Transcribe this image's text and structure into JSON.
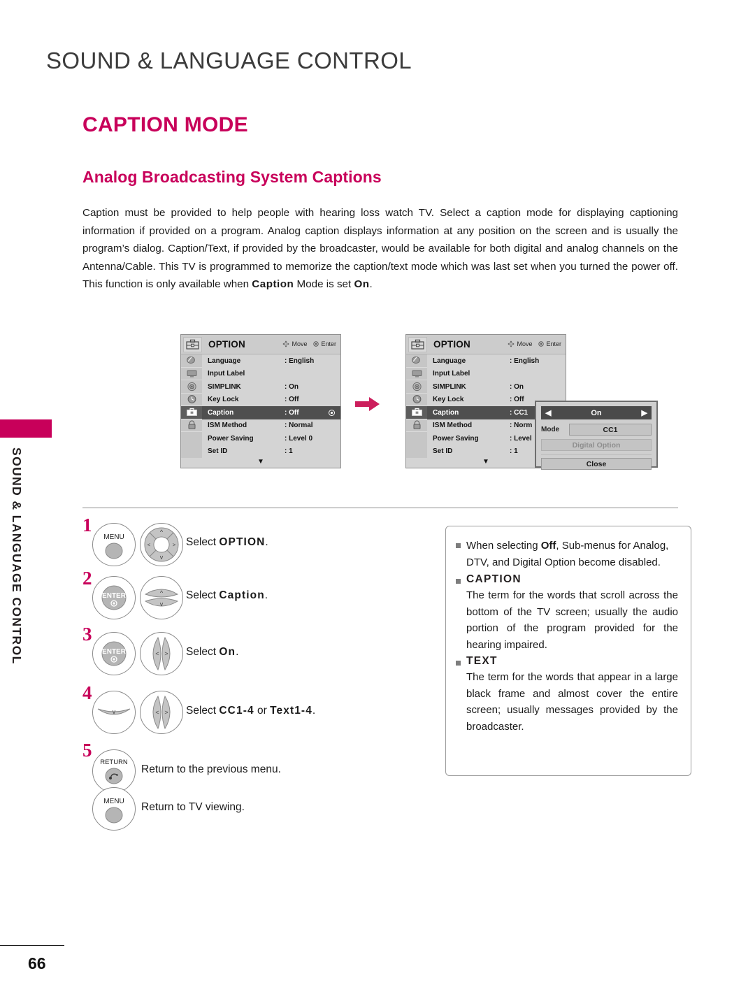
{
  "chapter": {
    "title": "SOUND & LANGUAGE CONTROL"
  },
  "side_tab": {
    "label": "SOUND & LANGUAGE CONTROL"
  },
  "section": {
    "title": "CAPTION MODE"
  },
  "subsection": {
    "title": "Analog Broadcasting System Captions"
  },
  "intro": {
    "part1": "Caption must be provided to help people with hearing loss watch TV. Select a caption mode for displaying captioning information if provided on a program. Analog caption displays information at any position on the screen and is usually the program’s dialog. Caption/Text, if provided by the broadcaster, would be available for both digital and analog channels on the Antenna/Cable. This TV is programmed to memorize the caption/text mode which was last set when you turned the power off. This function is only available when ",
    "bold1": "Caption",
    "part2": " Mode is set ",
    "bold2": "On",
    "part3": "."
  },
  "osd_left": {
    "title": "OPTION",
    "hint_move": "Move",
    "hint_enter": "Enter",
    "rows": [
      {
        "label": "Language",
        "value": ": English",
        "selected": false
      },
      {
        "label": "Input Label",
        "value": "",
        "selected": false
      },
      {
        "label": "SIMPLINK",
        "value": ": On",
        "selected": false
      },
      {
        "label": "Key Lock",
        "value": ": Off",
        "selected": false
      },
      {
        "label": "Caption",
        "value": ": Off",
        "selected": true
      },
      {
        "label": "ISM Method",
        "value": ": Normal",
        "selected": false
      },
      {
        "label": "Power Saving",
        "value": ": Level 0",
        "selected": false
      },
      {
        "label": "Set ID",
        "value": ": 1",
        "selected": false
      }
    ],
    "scroll_glyph": "▼"
  },
  "osd_right": {
    "title": "OPTION",
    "hint_move": "Move",
    "hint_enter": "Enter",
    "rows": [
      {
        "label": "Language",
        "value": ": English",
        "selected": false
      },
      {
        "label": "Input Label",
        "value": "",
        "selected": false
      },
      {
        "label": "SIMPLINK",
        "value": ": On",
        "selected": false
      },
      {
        "label": "Key Lock",
        "value": ": Off",
        "selected": false
      },
      {
        "label": "Caption",
        "value": ": CC1",
        "selected": true
      },
      {
        "label": "ISM Method",
        "value": ": Norm",
        "selected": false
      },
      {
        "label": "Power Saving",
        "value": ": Level",
        "selected": false
      },
      {
        "label": "Set ID",
        "value": ": 1",
        "selected": false
      }
    ],
    "scroll_glyph": "▼"
  },
  "caption_popup": {
    "onoff_value": "On",
    "arrow_left": "◀",
    "arrow_right": "▶",
    "mode_label": "Mode",
    "mode_value": "CC1",
    "digital_option": "Digital Option",
    "close": "Close"
  },
  "steps": [
    {
      "num": "1",
      "button": "MENU",
      "pad": "4way",
      "text_pre": "Select ",
      "text_bold": "OPTION",
      "text_post": "."
    },
    {
      "num": "2",
      "button": "ENTER",
      "pad": "updown",
      "text_pre": "Select ",
      "text_bold": "Caption",
      "text_post": "."
    },
    {
      "num": "3",
      "button": "ENTER",
      "pad": "leftright",
      "text_pre": "Select ",
      "text_bold": "On",
      "text_post": "."
    },
    {
      "num": "4",
      "button": "DOWN",
      "pad": "leftright",
      "text_pre": "Select ",
      "text_bold": "CC1-4",
      "text_mid": " or ",
      "text_bold2": "Text1-4",
      "text_post": "."
    },
    {
      "num": "5",
      "button": "RETURN",
      "pad": "none",
      "text_plain": "Return to the previous menu."
    },
    {
      "num": "",
      "button": "MENU",
      "pad": "none",
      "text_plain": "Return to TV viewing."
    }
  ],
  "info_box": {
    "bullet1_pre": "When selecting ",
    "bullet1_bold": "Off",
    "bullet1_post": ", Sub-menus for Analog, DTV, and Digital Option become disabled.",
    "caption_head": "CAPTION",
    "caption_body": "The term for the words that scroll across the bottom of the TV screen; usually the audio portion of the program provided for the hearing impaired.",
    "text_head": "TEXT",
    "text_body": "The term for the words that appear in a large black frame and almost cover the entire screen; usually messages provided by the broadcaster."
  },
  "footer": {
    "page_number": "66"
  },
  "colors": {
    "accent": "#c8005a",
    "text": "#231f20",
    "osd_bg": "#d4d4d4",
    "osd_sel": "#4f4f4f"
  }
}
